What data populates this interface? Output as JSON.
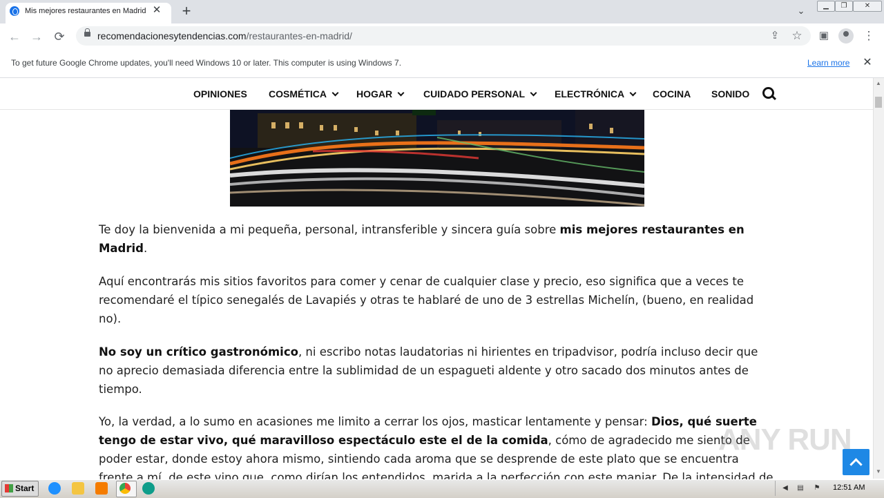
{
  "browser": {
    "tab": {
      "title": "Mis mejores restaurantes en Madrid",
      "close_glyph": "✕"
    },
    "new_tab_glyph": "+",
    "tab_search_glyph": "⌄",
    "window_controls": {
      "minimize": "▁",
      "restore": "❐",
      "close": "✕"
    },
    "nav": {
      "back": "←",
      "forward": "→",
      "reload": "⟳"
    },
    "address": {
      "host": "recomendacionesytendencias.com",
      "path": "/restaurantes-en-madrid/"
    },
    "toolbar_icons": {
      "share": "⇪",
      "bookmark": "☆",
      "side_panel": "▣",
      "menu": "⋮"
    }
  },
  "infobar": {
    "message": "To get future Google Chrome updates, you'll need Windows 10 or later. This computer is using Windows 7.",
    "link": "Learn more",
    "close_glyph": "✕"
  },
  "site_nav": {
    "items": [
      {
        "label": "OPINIONES",
        "has_dropdown": false
      },
      {
        "label": "COSMÉTICA",
        "has_dropdown": true
      },
      {
        "label": "HOGAR",
        "has_dropdown": true
      },
      {
        "label": "CUIDADO PERSONAL",
        "has_dropdown": true
      },
      {
        "label": "ELECTRÓNICA",
        "has_dropdown": true
      },
      {
        "label": "COCINA",
        "has_dropdown": false
      },
      {
        "label": "SONIDO",
        "has_dropdown": false
      }
    ]
  },
  "article": {
    "p1": {
      "a": "Te doy la bienvenida a mi pequeña, personal, intransferible y sincera guía sobre ",
      "b": "mis mejores restaurantes en Madrid",
      "c": "."
    },
    "p2": "Aquí encontrarás mis sitios favoritos para comer y cenar de cualquier clase y precio, eso significa que a veces te recomendaré el típico senegalés de Lavapiés y otras te hablaré de uno de 3 estrellas Michelín, (bueno, en realidad no).",
    "p3": {
      "b": "No soy un crítico gastronómico",
      "c": ", ni escribo notas laudatorias ni hirientes en tripadvisor, podría incluso decir que no aprecio demasiada diferencia entre la sublimidad de un espagueti aldente y otro sacado dos minutos antes de tiempo."
    },
    "p4": {
      "a": "Yo, la verdad, a lo sumo en acasiones me limito a cerrar los ojos, masticar lentamente y pensar: ",
      "b": "Dios, qué suerte tengo de estar vivo, qué maravilloso espectáculo este el de la comida",
      "c": ", cómo de agradecido me siento de poder estar, donde estoy ahora mismo, sintiendo cada aroma que se desprende de este plato que se encuentra frente a mí, de este vino que, como dirían los entendidos, marida a la perfección con este manjar. De la intensidad de ese"
    }
  },
  "watermark": "ANY RUN",
  "taskbar": {
    "start_label": "Start",
    "clock": "12:51 AM",
    "colors": {
      "ie": "#1e90ff",
      "explorer": "#f4c542",
      "media": "#f57c00",
      "chrome": "#34a853",
      "edge": "#0f9d8a"
    }
  }
}
